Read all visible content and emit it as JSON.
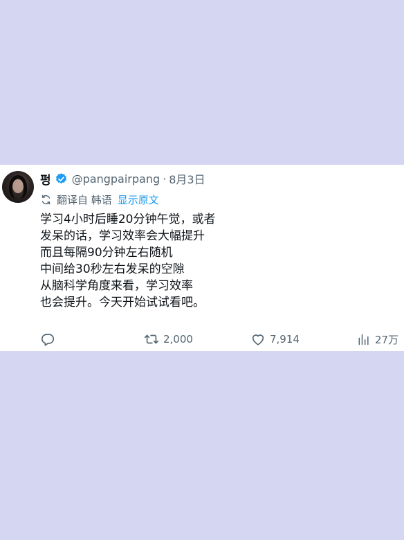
{
  "tweet": {
    "display_name": "펑",
    "handle": "@pangpairpang",
    "separator": "·",
    "date": "8月3日",
    "translated_from": "翻译自 韩语",
    "show_original": "显示原文",
    "lines": [
      "学习4小时后睡20分钟午觉，或者",
      "发呆的话，学习效率会大幅提升",
      "而且每隔90分钟左右随机",
      "中间给30秒左右发呆的空隙",
      "从脑科学角度来看，学习效率",
      "也会提升。今天开始试试看吧。"
    ],
    "retweets": "2,000",
    "likes": "7,914",
    "views": "27万"
  },
  "colors": {
    "background": "#d5d7f2",
    "accent": "#1d9bf0",
    "text": "#0f1419",
    "muted": "#536471"
  },
  "icons": [
    "verified-badge-icon",
    "translate-icon",
    "reply-icon",
    "retweet-icon",
    "like-icon",
    "views-icon"
  ]
}
